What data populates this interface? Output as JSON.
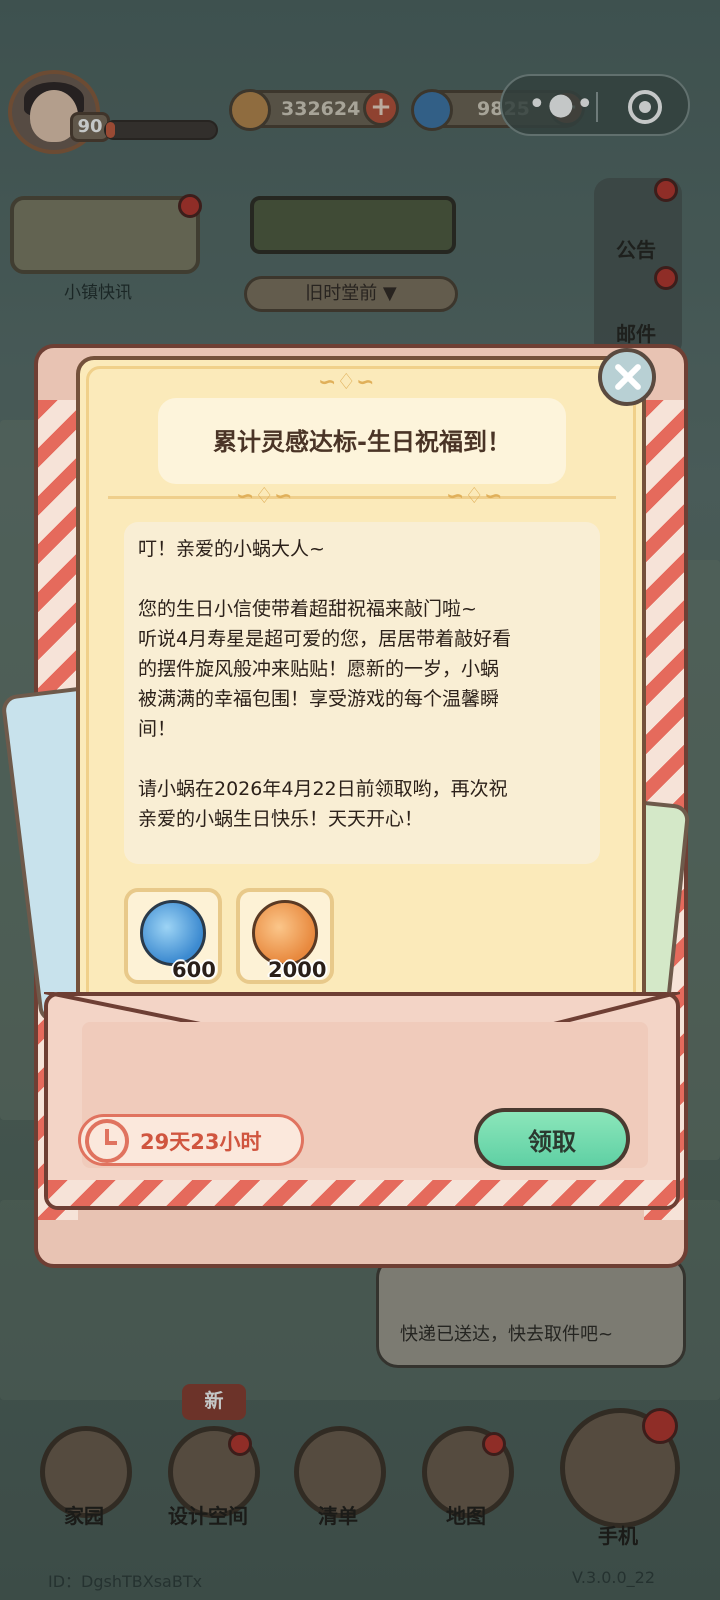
{
  "hud": {
    "level": "90",
    "xp_fraction": 0.08,
    "coins": "332624",
    "gems": "9825"
  },
  "top_left": {
    "news_label": "小镇快讯"
  },
  "top_center": {
    "scene_name": "旧时堂前"
  },
  "right_rail": {
    "announcement": "公告",
    "mail": "邮件"
  },
  "popup": {
    "title": "累计灵感达标-生日祝福到！",
    "body": "叮！亲爱的小蜗大人~\n\n您的生日小信使带着超甜祝福来敲门啦~\n听说4月寿星是超可爱的您，居居带着敲好看\n的摆件旋风般冲来贴贴！愿新的一岁，小蜗\n被满满的幸福包围！享受游戏的每个温馨瞬\n间！\n\n请小蜗在2026年4月22日前领取哟，再次祝\n亲爱的小蜗生日快乐！天天开心！",
    "rewards": [
      {
        "icon": "blue-swirl-icon",
        "qty": "600"
      },
      {
        "icon": "orange-leaf-coin-icon",
        "qty": "2000"
      }
    ],
    "timer": "29天23小时",
    "claim_label": "领取"
  },
  "chat": {
    "message": "快递已送达，快去取件吧~"
  },
  "bottom_nav": {
    "new_tag": "新",
    "items": [
      {
        "label": "家园"
      },
      {
        "label": "设计空间"
      },
      {
        "label": "清单"
      },
      {
        "label": "地图"
      },
      {
        "label": "手机"
      }
    ]
  },
  "footer": {
    "id": "ID：DgshTBXsaBTx",
    "version": "V.3.0.0_22"
  },
  "colors": {
    "accent_green": "#5fd0a4",
    "timer_red": "#d0553f",
    "letter_bg": "#fbeaba"
  }
}
